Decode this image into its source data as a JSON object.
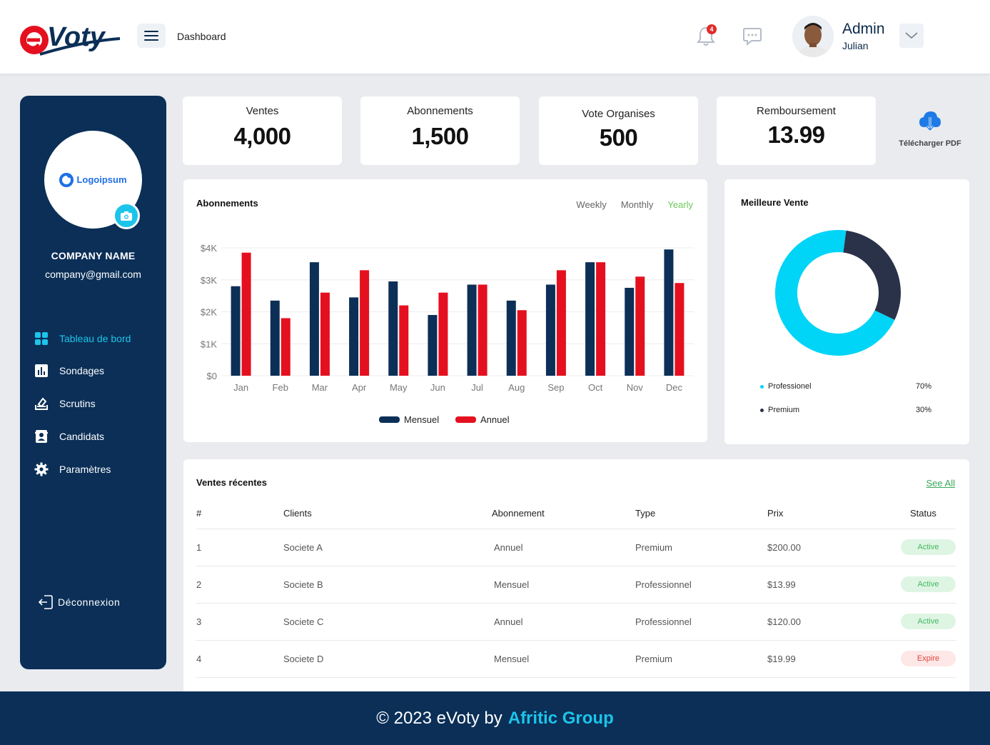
{
  "header": {
    "logo_text": "eVoty",
    "breadcrumb": "Dashboard",
    "notification_count": "4",
    "user_title": "Admin",
    "user_name": "Julian"
  },
  "sidebar": {
    "company_name": "COMPANY NAME",
    "company_email": "company@gmail.com",
    "logo_text": "Logoipsum",
    "items": [
      {
        "label": "Tableau de bord",
        "icon": "grid-icon",
        "active": true
      },
      {
        "label": "Sondages",
        "icon": "bar-chart-icon",
        "active": false
      },
      {
        "label": "Scrutins",
        "icon": "ballot-icon",
        "active": false
      },
      {
        "label": "Candidats",
        "icon": "contact-card-icon",
        "active": false
      },
      {
        "label": "Paramètres",
        "icon": "gear-icon",
        "active": false
      }
    ],
    "logout_label": "Déconnexion"
  },
  "stats": [
    {
      "label": "Ventes",
      "value": "4,000"
    },
    {
      "label": "Abonnements",
      "value": "1,500"
    },
    {
      "label": "Vote Organises",
      "value": "500"
    },
    {
      "label": "Remboursement",
      "value": "13.99"
    }
  ],
  "pdf_label": "Télécharger PDF",
  "chart": {
    "title": "Abonnements",
    "tabs": [
      "Weekly",
      "Monthly",
      "Yearly"
    ],
    "active_tab": "Yearly"
  },
  "chart_data": {
    "type": "bar",
    "title": "Abonnements",
    "categories": [
      "Jan",
      "Feb",
      "Mar",
      "Apr",
      "May",
      "Jun",
      "Jul",
      "Aug",
      "Sep",
      "Oct",
      "Nov",
      "Dec"
    ],
    "series": [
      {
        "name": "Mensuel",
        "color": "#0b2f57",
        "values": [
          2800,
          2350,
          3550,
          2450,
          2950,
          1900,
          2850,
          2350,
          2850,
          3550,
          2750,
          3950
        ]
      },
      {
        "name": "Annuel",
        "color": "#e5101f",
        "values": [
          3850,
          1800,
          2600,
          3300,
          2200,
          2600,
          2850,
          2050,
          3300,
          3550,
          3100,
          2900
        ]
      }
    ],
    "yticks": [
      "$0",
      "$1K",
      "$2K",
      "$3K",
      "$4K"
    ],
    "ylim": [
      0,
      4000
    ],
    "legend_position": "bottom",
    "grid": true
  },
  "donut": {
    "title": "Meilleure Vente",
    "segments": [
      {
        "name": "Professionel",
        "value": 70,
        "display": "70%",
        "color": "#00d4f7"
      },
      {
        "name": "Premium",
        "value": 30,
        "display": "30%",
        "color": "#2a3249"
      }
    ]
  },
  "table": {
    "title": "Ventes récentes",
    "see_all": "See All",
    "headers": [
      "#",
      "Clients",
      "Abonnement",
      "Type",
      "Prix",
      "Status"
    ],
    "rows": [
      {
        "num": "1",
        "client": "Societe A",
        "plan": "Annuel",
        "type": "Premium",
        "price": "$200.00",
        "status": "Active"
      },
      {
        "num": "2",
        "client": "Societe B",
        "plan": "Mensuel",
        "type": "Professionnel",
        "price": "$13.99",
        "status": "Active"
      },
      {
        "num": "3",
        "client": "Societe C",
        "plan": "Annuel",
        "type": "Professionnel",
        "price": "$120.00",
        "status": "Active"
      },
      {
        "num": "4",
        "client": "Societe D",
        "plan": "Mensuel",
        "type": "Premium",
        "price": "$19.99",
        "status": "Expire"
      }
    ]
  },
  "footer": {
    "text": "© 2023 eVoty by",
    "brand": "Afritic Group"
  }
}
